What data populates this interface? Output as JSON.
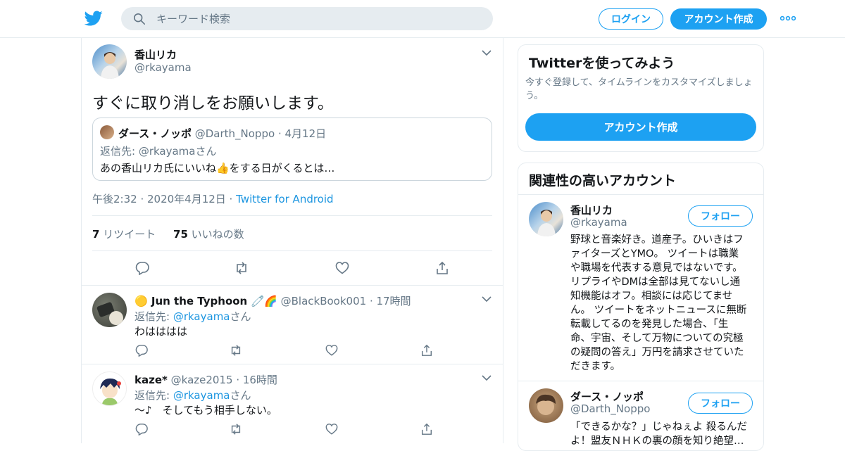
{
  "header": {
    "search_placeholder": "キーワード検索",
    "login_label": "ログイン",
    "signup_label": "アカウント作成"
  },
  "tweet": {
    "author_name": "香山リカ",
    "author_handle": "@rkayama",
    "text": "すぐに取り消しをお願いします。",
    "quote": {
      "name": "ダース・ノッポ",
      "handle": "@Darth_Noppo",
      "sep": "·",
      "date": "4月12日",
      "reply_to": "返信先: @rkayamaさん",
      "text": "あの香山リカ氏にいいね👍をする日がくるとは…"
    },
    "timestamp": "午後2:32 · 2020年4月12日 ·",
    "source": "Twitter for Android",
    "retweet_count": "7",
    "retweet_label": "リツイート",
    "like_count": "75",
    "like_label": "いいねの数"
  },
  "replies": [
    {
      "name": "🟡 Jun the Typhoon 🧷🌈",
      "handle": "@BlackBook001",
      "time": "· 17時間",
      "reply_prefix": "返信先:",
      "reply_handle": "@rkayama",
      "reply_suffix": "さん",
      "text": "わはははは"
    },
    {
      "name": "kaze*",
      "handle": "@kaze2015",
      "time": "· 16時間",
      "reply_prefix": "返信先:",
      "reply_handle": "@rkayama",
      "reply_suffix": "さん",
      "text": "～♪　そしてもう相手しない。"
    }
  ],
  "signup_card": {
    "title": "Twitterを使ってみよう",
    "desc_line1": "今すぐ登録して、タイムラインをカスタマイズしましょ",
    "desc_line2": "う。",
    "button": "アカウント作成"
  },
  "related": {
    "title": "関連性の高いアカウント",
    "follow_label": "フォロー",
    "accounts": [
      {
        "name": "香山リカ",
        "handle": "@rkayama",
        "bio_lines": [
          "野球と音楽好き。道産子。ひいきはフ",
          "ァイターズとYMO。 ツイートは職業",
          "や職場を代表する意見ではないです。",
          "リプライやDMは全部は見てないし通",
          "知機能はオフ。相談には応じてませ",
          "ん。 ツイートをネットニュースに無断",
          "転載してるのを発見した場合、「生",
          "命、宇宙、そして万物についての究極",
          "の疑問の答え」万円を請求させていた",
          "だきます。"
        ]
      },
      {
        "name": "ダース・ノッポ",
        "handle": "@Darth_Noppo",
        "bio_lines": [
          "「できるかな？」じゃねぇよ 殺るんだ",
          "よ！盟友ＮＨＫの裏の顔を知り絶望…"
        ]
      }
    ]
  },
  "colors": {
    "accent": "#1da1f2",
    "link": "#1b95e0",
    "secondary_text": "#657786",
    "border": "#e6ecf0"
  }
}
